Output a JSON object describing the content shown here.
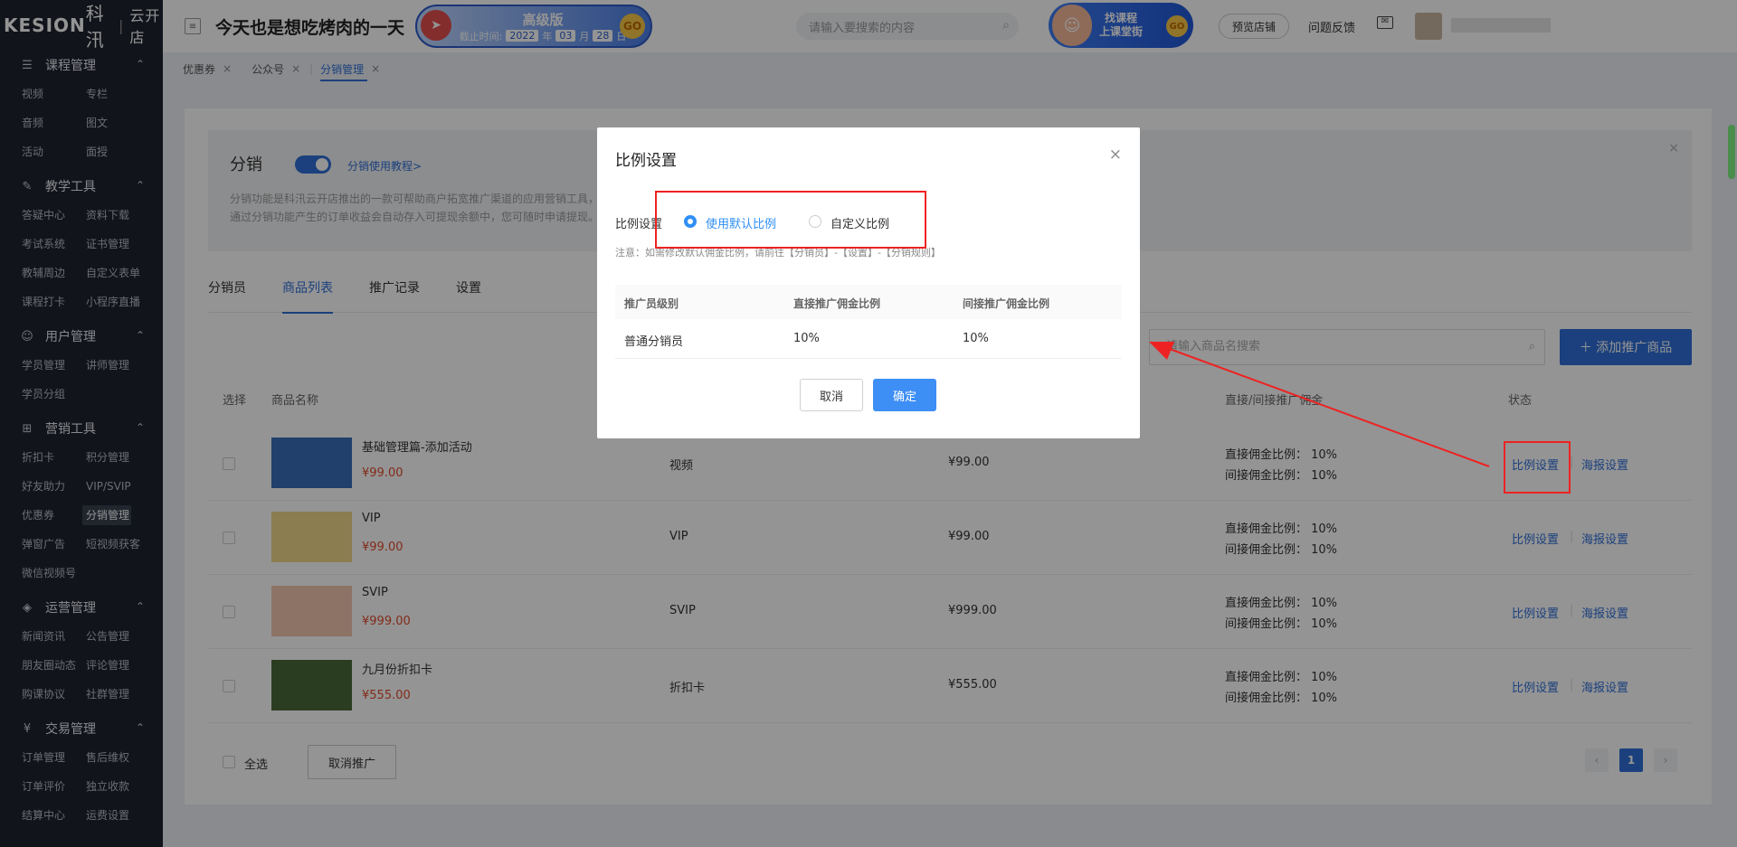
{
  "brand": {
    "logo_k": "KESION",
    "logo_cn": "科汛",
    "logo_sub": "云开店"
  },
  "sidebar": [
    {
      "title": "课程管理",
      "icon": "document-icon",
      "items": [
        "视频",
        "专栏",
        "音频",
        "图文",
        "活动",
        "面授"
      ]
    },
    {
      "title": "教学工具",
      "icon": "tools-icon",
      "items": [
        "答疑中心",
        "资料下载",
        "考试系统",
        "证书管理",
        "教辅周边",
        "自定义表单",
        "课程打卡",
        "小程序直播"
      ]
    },
    {
      "title": "用户管理",
      "icon": "user-icon",
      "items": [
        "学员管理",
        "讲师管理",
        "学员分组"
      ]
    },
    {
      "title": "营销工具",
      "icon": "gift-icon",
      "items": [
        "折扣卡",
        "积分管理",
        "好友助力",
        "VIP/SVIP",
        "优惠券",
        "分销管理",
        "弹窗广告",
        "短视频获客",
        "微信视频号"
      ]
    },
    {
      "title": "运营管理",
      "icon": "layers-icon",
      "items": [
        "新闻资讯",
        "公告管理",
        "朋友圈动态",
        "评论管理",
        "购课协议",
        "社群管理"
      ]
    },
    {
      "title": "交易管理",
      "icon": "yen-icon",
      "items": [
        "订单管理",
        "售后维权",
        "订单评价",
        "独立收款",
        "结算中心",
        "运费设置"
      ]
    }
  ],
  "sidebar_active": "分销管理",
  "topbar": {
    "collapse_icon": "menu-collapse-icon",
    "shop_name": "今天也是想吃烤肉的一天",
    "edition": "高级版",
    "expiry_label": "截止时间:",
    "expiry_year": "2022",
    "year_unit": "年",
    "expiry_month": "03",
    "month_unit": "月",
    "expiry_day": "28",
    "day_unit": "日",
    "go": "GO",
    "search_placeholder": "请输入要搜索的内容",
    "promo_line1": "找课程",
    "promo_line2": "上课堂街",
    "preview_store": "预览店铺",
    "feedback": "问题反馈"
  },
  "tabs": [
    {
      "label": "优惠券",
      "active": false
    },
    {
      "label": "公众号",
      "active": false
    },
    {
      "label": "分销管理",
      "active": true
    }
  ],
  "notice": {
    "title": "分销",
    "tutorial": "分销使用教程>",
    "desc1": "分销功能是科汛云开店推出的一款可帮助商户拓宽推广渠道的应用营销工具，",
    "desc2": "通过分销功能产生的订单收益会自动存入可提现余额中，您可随时申请提现。"
  },
  "subtabs": [
    "分销员",
    "商品列表",
    "推广记录",
    "设置"
  ],
  "subtab_active": 1,
  "product_search_placeholder": "请输入商品名搜索",
  "add_button": "＋ 添加推广商品",
  "table_headers": {
    "select": "选择",
    "name": "商品名称",
    "commission": "直接/间接推广佣金",
    "status": "状态"
  },
  "products": [
    {
      "name": "基础管理篇-添加活动",
      "price": "¥99.00",
      "type": "视频",
      "amount": "¥99.00",
      "direct": "直接佣金比例： 10%",
      "indirect": "间接佣金比例： 10%",
      "thumb_color": "#3a6fb8"
    },
    {
      "name": "VIP",
      "price": "¥99.00",
      "type": "VIP",
      "amount": "¥99.00",
      "direct": "直接佣金比例： 10%",
      "indirect": "间接佣金比例： 10%",
      "thumb_color": "#f0d88a"
    },
    {
      "name": "SVIP",
      "price": "¥999.00",
      "type": "SVIP",
      "amount": "¥999.00",
      "direct": "直接佣金比例： 10%",
      "indirect": "间接佣金比例： 10%",
      "thumb_color": "#f2c6b0"
    },
    {
      "name": "九月份折扣卡",
      "price": "¥555.00",
      "type": "折扣卡",
      "amount": "¥555.00",
      "direct": "直接佣金比例： 10%",
      "indirect": "间接佣金比例： 10%",
      "thumb_color": "#4a6a3a"
    }
  ],
  "row_actions": {
    "ratio": "比例设置",
    "poster": "海报设置"
  },
  "footer": {
    "select_all": "全选",
    "cancel_promo": "取消推广",
    "page": "1",
    "prev": "‹",
    "next": "›"
  },
  "modal": {
    "title": "比例设置",
    "close": "×",
    "label": "比例设置",
    "option_default": "使用默认比例",
    "option_custom": "自定义比例",
    "selected": "使用默认比例",
    "note": "注意：如需修改默认佣金比例，请前往【分销员】-【设置】-【分销规则】",
    "headers": [
      "推广员级别",
      "直接推广佣金比例",
      "间接推广佣金比例"
    ],
    "rows": [
      [
        "普通分销员",
        "10%",
        "10%"
      ]
    ],
    "cancel": "取消",
    "confirm": "确定"
  },
  "colors": {
    "accent": "#2f6fd8",
    "price": "#e04b2c",
    "highlight": "#ee2222",
    "sidebar": "#1f2430"
  }
}
